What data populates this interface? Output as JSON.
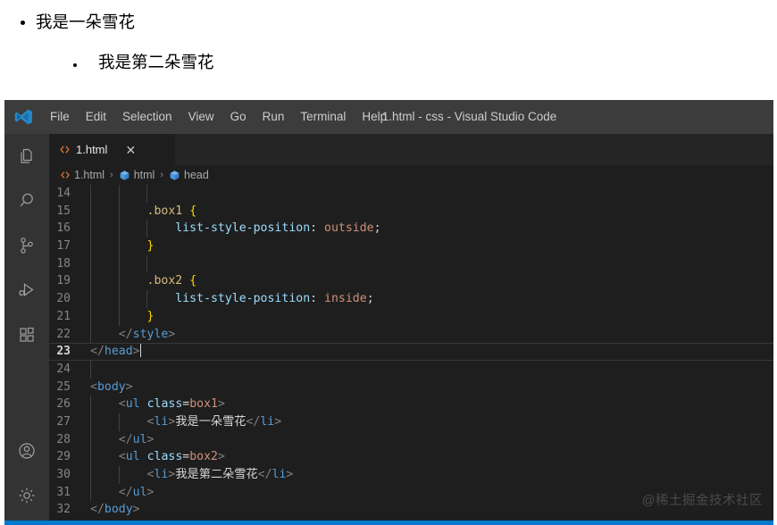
{
  "preview": {
    "list_outside": {
      "class_name": "box1",
      "items": [
        "我是一朵雪花"
      ]
    },
    "list_inside": {
      "class_name": "box2",
      "items": [
        "我是第二朵雪花"
      ]
    }
  },
  "titlebar": {
    "logo_icon": "vscode-logo-icon",
    "window_title": "1.html - css - Visual Studio Code",
    "menus": [
      {
        "label": "File"
      },
      {
        "label": "Edit"
      },
      {
        "label": "Selection"
      },
      {
        "label": "View"
      },
      {
        "label": "Go"
      },
      {
        "label": "Run"
      },
      {
        "label": "Terminal"
      },
      {
        "label": "Help"
      }
    ]
  },
  "activity_bar": {
    "items": [
      {
        "name": "explorer-icon",
        "title": "Explorer"
      },
      {
        "name": "search-icon",
        "title": "Search"
      },
      {
        "name": "source-control-icon",
        "title": "Source Control"
      },
      {
        "name": "run-and-debug-icon",
        "title": "Run and Debug"
      },
      {
        "name": "extensions-icon",
        "title": "Extensions"
      }
    ],
    "bottom_items": [
      {
        "name": "account-icon",
        "title": "Accounts"
      },
      {
        "name": "settings-gear-icon",
        "title": "Manage"
      }
    ]
  },
  "tab": {
    "file_icon": "html-file-icon",
    "label": "1.html",
    "close_icon": "close-icon"
  },
  "breadcrumb": {
    "separator": "›",
    "crumbs": [
      {
        "icon": "html-file-icon",
        "label": "1.html"
      },
      {
        "icon": "symbol-cube-icon",
        "label": "html"
      },
      {
        "icon": "symbol-cube-icon",
        "label": "head"
      }
    ]
  },
  "editor": {
    "active_line": 23,
    "first_visible_line": 14,
    "lines": [
      {
        "n": 14,
        "tokens": []
      },
      {
        "n": 15,
        "tokens": [
          {
            "t": "        ",
            "c": "t-text"
          },
          {
            "t": ".box1",
            "c": "t-selector"
          },
          {
            "t": " ",
            "c": "t-text"
          },
          {
            "t": "{",
            "c": "t-brace"
          }
        ]
      },
      {
        "n": 16,
        "tokens": [
          {
            "t": "            ",
            "c": "t-text"
          },
          {
            "t": "list-style-position",
            "c": "t-prop"
          },
          {
            "t": ":",
            "c": "t-punct"
          },
          {
            "t": " ",
            "c": "t-text"
          },
          {
            "t": "outside",
            "c": "t-value"
          },
          {
            "t": ";",
            "c": "t-punct"
          }
        ]
      },
      {
        "n": 17,
        "tokens": [
          {
            "t": "        ",
            "c": "t-text"
          },
          {
            "t": "}",
            "c": "t-brace"
          }
        ]
      },
      {
        "n": 18,
        "tokens": []
      },
      {
        "n": 19,
        "tokens": [
          {
            "t": "        ",
            "c": "t-text"
          },
          {
            "t": ".box2",
            "c": "t-selector"
          },
          {
            "t": " ",
            "c": "t-text"
          },
          {
            "t": "{",
            "c": "t-brace"
          }
        ]
      },
      {
        "n": 20,
        "tokens": [
          {
            "t": "            ",
            "c": "t-text"
          },
          {
            "t": "list-style-position",
            "c": "t-prop"
          },
          {
            "t": ":",
            "c": "t-punct"
          },
          {
            "t": " ",
            "c": "t-text"
          },
          {
            "t": "inside",
            "c": "t-value"
          },
          {
            "t": ";",
            "c": "t-punct"
          }
        ]
      },
      {
        "n": 21,
        "tokens": [
          {
            "t": "        ",
            "c": "t-text"
          },
          {
            "t": "}",
            "c": "t-brace"
          }
        ]
      },
      {
        "n": 22,
        "tokens": [
          {
            "t": "    ",
            "c": "t-text"
          },
          {
            "t": "</",
            "c": "t-tagbracket"
          },
          {
            "t": "style",
            "c": "t-tag"
          },
          {
            "t": ">",
            "c": "t-tagbracket"
          }
        ]
      },
      {
        "n": 23,
        "tokens": [
          {
            "t": "</",
            "c": "t-tagbracket"
          },
          {
            "t": "head",
            "c": "t-tag"
          },
          {
            "t": ">",
            "c": "t-tagbracket"
          }
        ]
      },
      {
        "n": 24,
        "tokens": []
      },
      {
        "n": 25,
        "tokens": [
          {
            "t": "<",
            "c": "t-tagbracket"
          },
          {
            "t": "body",
            "c": "t-tag"
          },
          {
            "t": ">",
            "c": "t-tagbracket"
          }
        ]
      },
      {
        "n": 26,
        "tokens": [
          {
            "t": "    ",
            "c": "t-text"
          },
          {
            "t": "<",
            "c": "t-tagbracket"
          },
          {
            "t": "ul",
            "c": "t-tag"
          },
          {
            "t": " ",
            "c": "t-text"
          },
          {
            "t": "class",
            "c": "t-attr"
          },
          {
            "t": "=",
            "c": "t-punct"
          },
          {
            "t": "box1",
            "c": "t-attrval"
          },
          {
            "t": ">",
            "c": "t-tagbracket"
          }
        ]
      },
      {
        "n": 27,
        "tokens": [
          {
            "t": "        ",
            "c": "t-text"
          },
          {
            "t": "<",
            "c": "t-tagbracket"
          },
          {
            "t": "li",
            "c": "t-tag"
          },
          {
            "t": ">",
            "c": "t-tagbracket"
          },
          {
            "t": "我是一朵雪花",
            "c": "t-text"
          },
          {
            "t": "</",
            "c": "t-tagbracket"
          },
          {
            "t": "li",
            "c": "t-tag"
          },
          {
            "t": ">",
            "c": "t-tagbracket"
          }
        ]
      },
      {
        "n": 28,
        "tokens": [
          {
            "t": "    ",
            "c": "t-text"
          },
          {
            "t": "</",
            "c": "t-tagbracket"
          },
          {
            "t": "ul",
            "c": "t-tag"
          },
          {
            "t": ">",
            "c": "t-tagbracket"
          }
        ]
      },
      {
        "n": 29,
        "tokens": [
          {
            "t": "    ",
            "c": "t-text"
          },
          {
            "t": "<",
            "c": "t-tagbracket"
          },
          {
            "t": "ul",
            "c": "t-tag"
          },
          {
            "t": " ",
            "c": "t-text"
          },
          {
            "t": "class",
            "c": "t-attr"
          },
          {
            "t": "=",
            "c": "t-punct"
          },
          {
            "t": "box2",
            "c": "t-attrval"
          },
          {
            "t": ">",
            "c": "t-tagbracket"
          }
        ]
      },
      {
        "n": 30,
        "tokens": [
          {
            "t": "        ",
            "c": "t-text"
          },
          {
            "t": "<",
            "c": "t-tagbracket"
          },
          {
            "t": "li",
            "c": "t-tag"
          },
          {
            "t": ">",
            "c": "t-tagbracket"
          },
          {
            "t": "我是第二朵雪花",
            "c": "t-text"
          },
          {
            "t": "</",
            "c": "t-tagbracket"
          },
          {
            "t": "li",
            "c": "t-tag"
          },
          {
            "t": ">",
            "c": "t-tagbracket"
          }
        ]
      },
      {
        "n": 31,
        "tokens": [
          {
            "t": "    ",
            "c": "t-text"
          },
          {
            "t": "</",
            "c": "t-tagbracket"
          },
          {
            "t": "ul",
            "c": "t-tag"
          },
          {
            "t": ">",
            "c": "t-tagbracket"
          }
        ]
      },
      {
        "n": 32,
        "tokens": [
          {
            "t": "</",
            "c": "t-tagbracket"
          },
          {
            "t": "body",
            "c": "t-tag"
          },
          {
            "t": ">",
            "c": "t-tagbracket"
          }
        ]
      }
    ]
  },
  "watermark": {
    "text": "@稀土掘金技术社区"
  },
  "colors": {
    "titlebar_bg": "#3c3c3c",
    "activitybar_bg": "#333333",
    "editor_bg": "#1e1e1e",
    "tabbar_bg": "#252526",
    "statusbar_bg": "#007acc",
    "accent_blue": "#569cd6",
    "string_orange": "#ce9178",
    "attr_lightblue": "#9cdcfe",
    "selector_gold": "#d7ba7d",
    "brace_yellow": "#ffd700"
  }
}
